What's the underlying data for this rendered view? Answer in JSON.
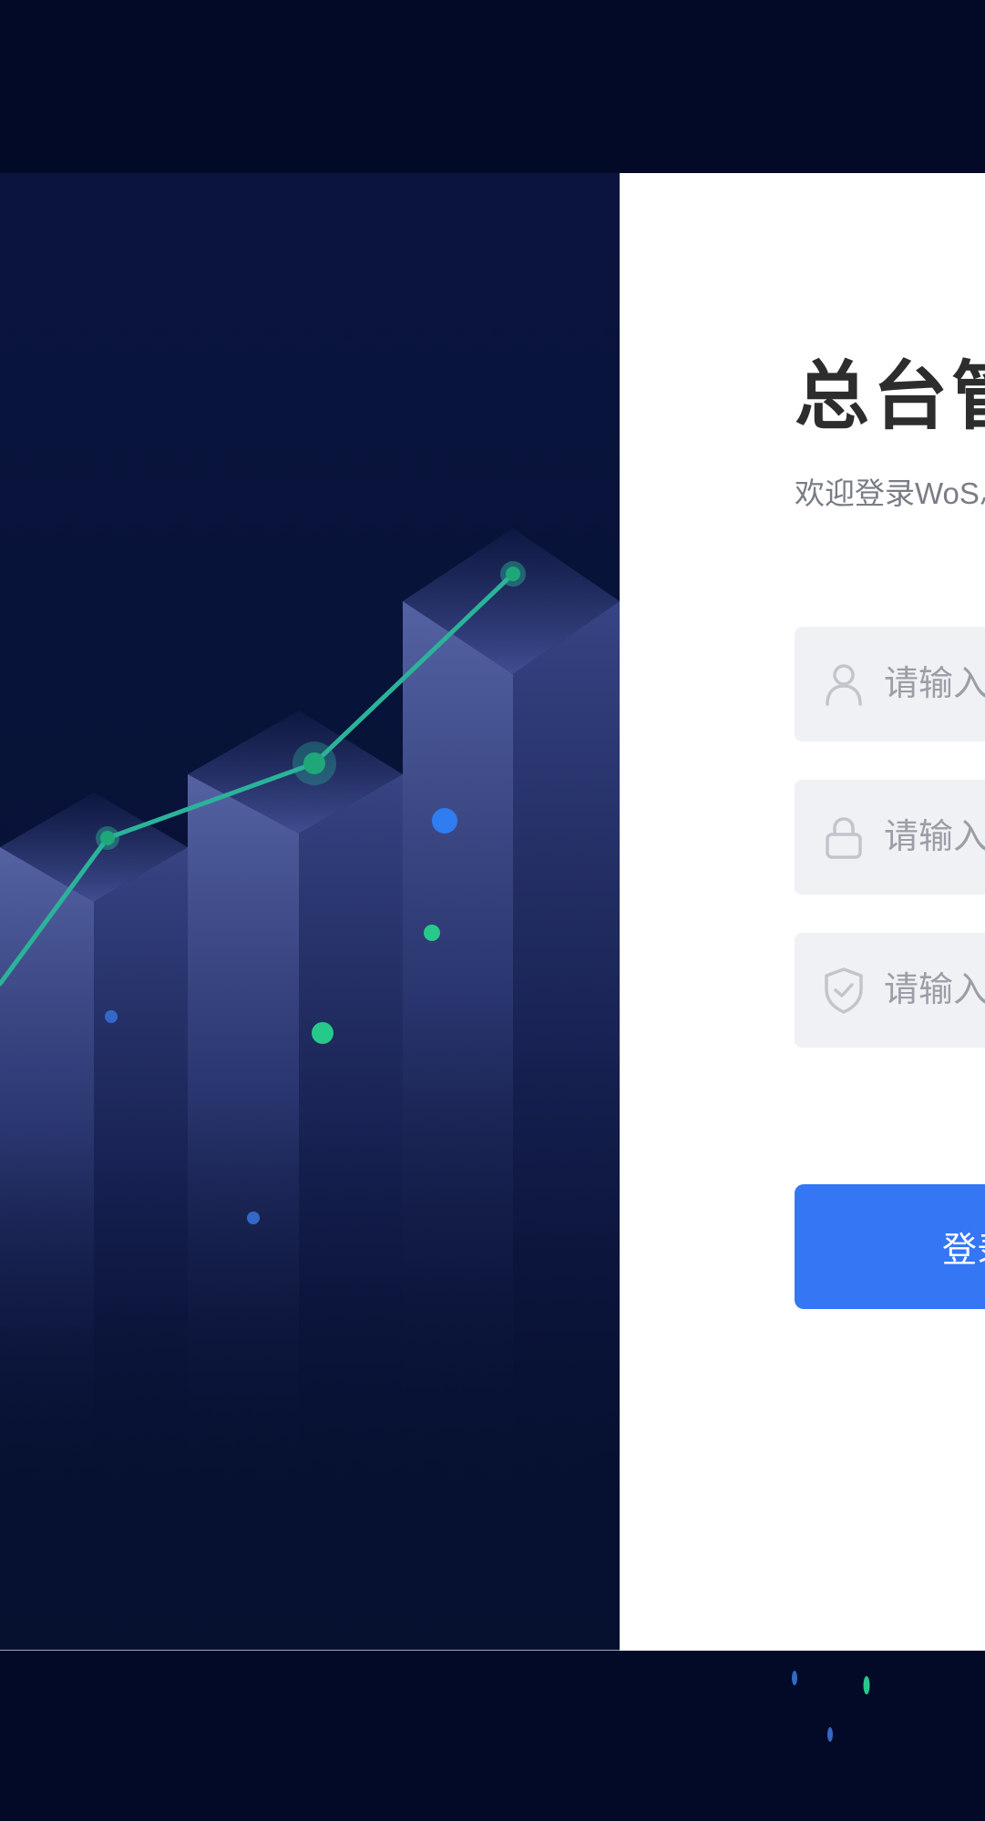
{
  "login": {
    "title": "总台管理系统",
    "subtitle": "欢迎登录WoS总台管理系统",
    "username_placeholder": "请输入用户名",
    "password_placeholder": "请输入密码",
    "captcha_placeholder": "请输入验证码",
    "submit_label": "登录"
  },
  "icons": {
    "username": "user-icon",
    "password": "lock-icon",
    "captcha": "shield-check-icon"
  },
  "colors": {
    "page_background": "#020a28",
    "hero_background": "#081339",
    "chart_line": "#2bb39a",
    "chart_point": "#1fa779",
    "accent_blue": "#3576f5",
    "field_background": "#f0f1f5",
    "title_text": "#2d2d2d",
    "subtitle_text": "#7a7d86"
  }
}
